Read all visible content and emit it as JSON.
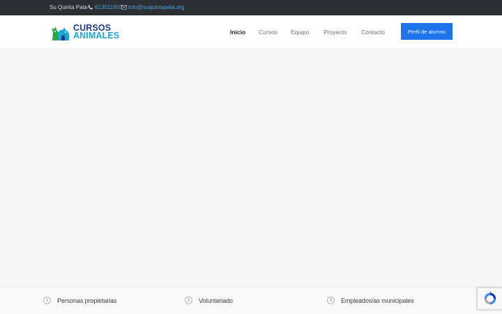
{
  "topbar": {
    "brand": "Su Quinta Pata",
    "phone": "613011655",
    "email": "info@suquintapata.org"
  },
  "logo": {
    "line1": "CURSOS",
    "line2": "ANIMALES"
  },
  "nav": {
    "items": [
      "Inicio",
      "Cursos",
      "Equipo",
      "Proyecto",
      "Contacto"
    ],
    "active": "Inicio",
    "cta": "Perfil de alumno"
  },
  "strip": {
    "items": [
      {
        "num": "1",
        "label": "Personas propietarias"
      },
      {
        "num": "2",
        "label": "Voluntariado"
      },
      {
        "num": "3",
        "label": "Empleados/as municipales"
      }
    ]
  },
  "colors": {
    "topbar_bg": "#2b2e33",
    "accent": "#1e73e8",
    "link": "#4aa3df",
    "logo_dark": "#1f3b8f",
    "logo_light": "#1aa6d9"
  }
}
